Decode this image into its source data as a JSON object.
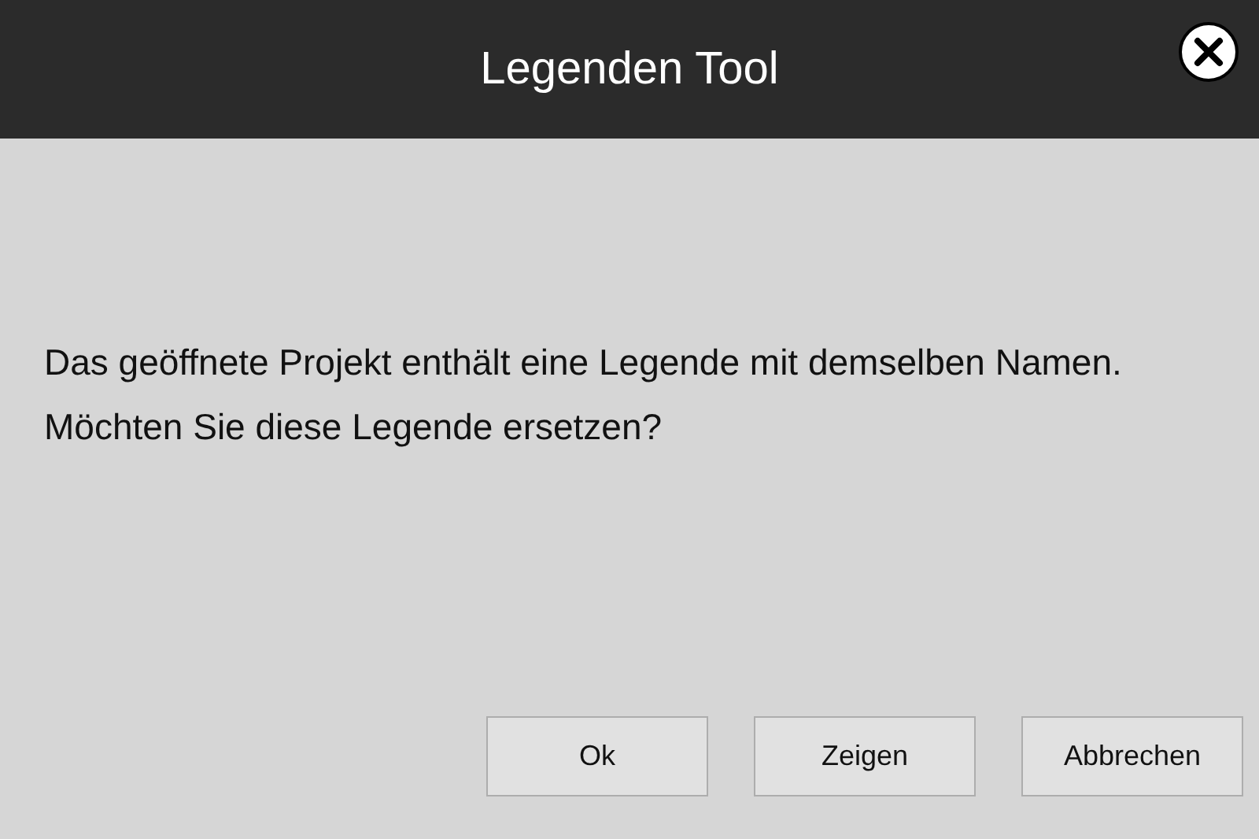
{
  "window": {
    "title": "Legenden Tool"
  },
  "message": "Das geöffnete Projekt enthält eine Legende mit demselben Namen. Möchten Sie diese Legende ersetzen?",
  "buttons": [
    "Ok",
    "Zeigen",
    "Abbrechen"
  ]
}
